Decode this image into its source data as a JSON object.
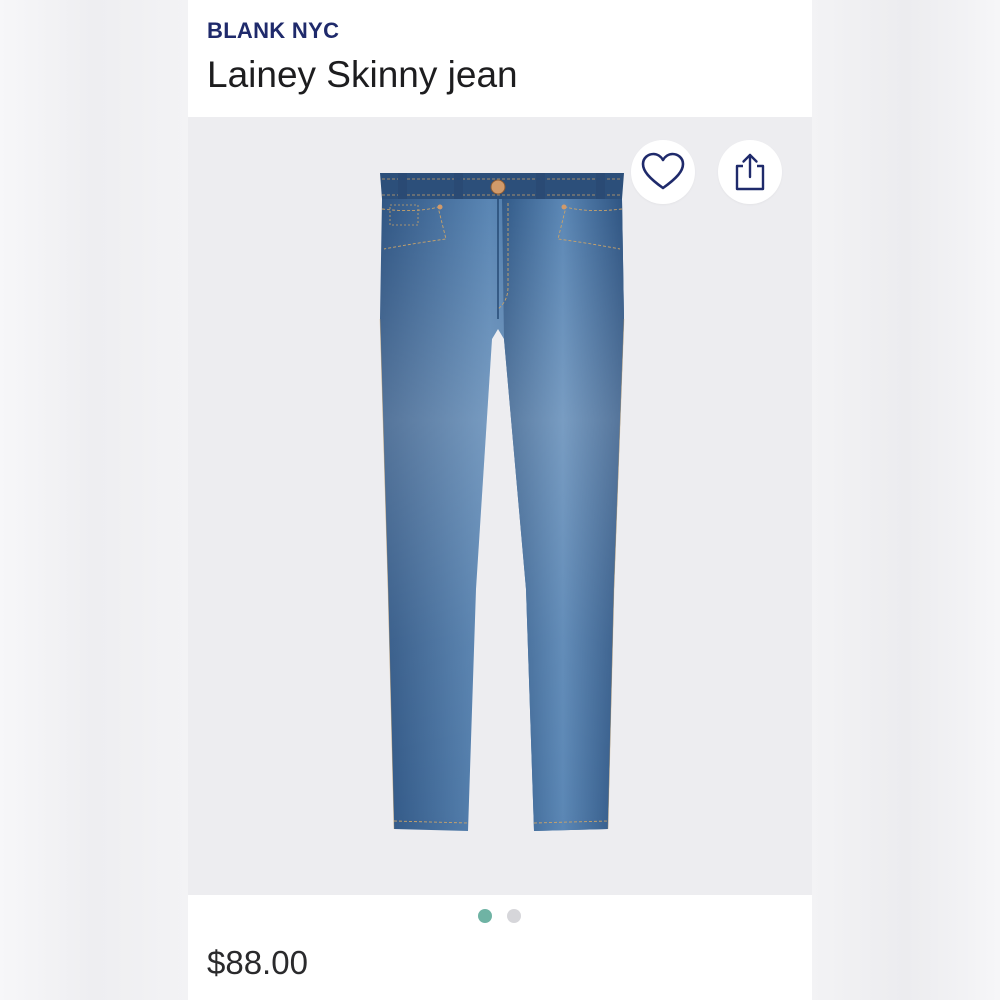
{
  "product": {
    "brand": "BLANK NYC",
    "name": "Lainey Skinny jean",
    "price": "$88.00"
  },
  "actions": {
    "favorite_icon": "heart-outline-icon",
    "share_icon": "share-upload-icon"
  },
  "gallery": {
    "image_count": 2,
    "active_index": 0,
    "image_subject": "jeans"
  },
  "colors": {
    "brand_text": "#1f2a6b",
    "active_dot": "#6fb3a4",
    "inactive_dot": "#d6d6da",
    "denim": "#3e6b99"
  }
}
